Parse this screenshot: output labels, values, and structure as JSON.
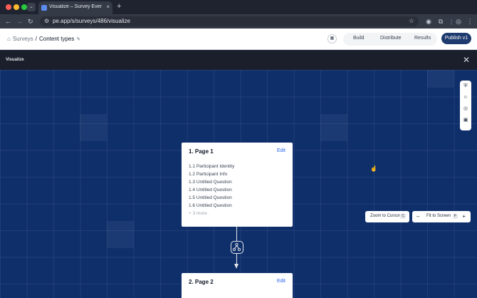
{
  "browser": {
    "tab_title": "Visualize – Survey Everywhe",
    "url": "pe.app/s/surveys/486/visualize",
    "tab_list_glyph": "⌄",
    "new_tab_glyph": "+",
    "tab_close_glyph": "×",
    "colors": {
      "close": "#ff5f57",
      "minimize": "#febc2e",
      "maximize": "#28c840"
    }
  },
  "header": {
    "breadcrumb": {
      "home_icon": "home-icon",
      "root": "Surveys",
      "separator": "/",
      "current": "Content types",
      "edit_icon": "pencil-icon"
    },
    "tabs": [
      {
        "label": "Build"
      },
      {
        "label": "Distribute"
      },
      {
        "label": "Results"
      }
    ],
    "publish_label": "Publish v1",
    "accent": "#1e3a6e"
  },
  "modal": {
    "title": "Visualize",
    "close_icon": "close-icon"
  },
  "canvas": {
    "background": "#0f2f6b",
    "pages": [
      {
        "title": "1. Page 1",
        "edit_label": "Edit",
        "questions": [
          "1.1 Participant Identity",
          "1.2 Participant Info",
          "1.3 Untitled Question",
          "1.4 Untitled Question",
          "1.5 Untitled Question",
          "1.6 Untitled Question"
        ],
        "more": "+ 3 more"
      },
      {
        "title": "2. Page 2",
        "edit_label": "Edit",
        "questions": [],
        "more": ""
      }
    ]
  },
  "controls": {
    "zoom_to_cursor": {
      "label": "Zoom to Cursor",
      "shortcut": "C"
    },
    "zoom_out": "–",
    "fit_to_screen": {
      "label": "Fit to Screen",
      "shortcut": "F"
    },
    "zoom_in": "+"
  },
  "side_rail": [
    "shield-icon",
    "users-icon",
    "compass-icon",
    "settings-icon"
  ]
}
